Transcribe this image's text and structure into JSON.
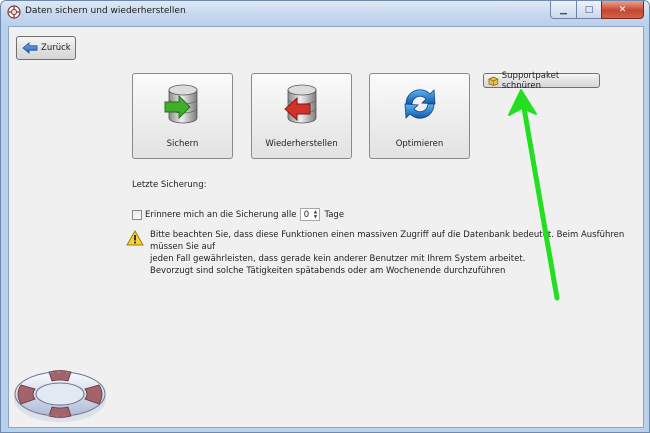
{
  "window": {
    "title": "Daten sichern und wiederherstellen",
    "controls": {
      "minimize": "▁",
      "maximize": "□",
      "close": "✕"
    }
  },
  "toolbar": {
    "back_label": "Zurück"
  },
  "actions": {
    "backup_label": "Sichern",
    "restore_label": "Wiederherstellen",
    "optimize_label": "Optimieren",
    "support_label": "Supportpaket schnüren"
  },
  "status": {
    "last_backup_label": "Letzte Sicherung:",
    "remind_prefix": "Erinnere mich an die Sicherung alle",
    "remind_value": "0",
    "remind_suffix": "Tage"
  },
  "warning": {
    "line1": "Bitte beachten Sie, dass diese Funktionen einen massiven Zugriff auf die Datenbank bedeutet. Beim Ausführen müssen Sie auf",
    "line2": "jeden Fall gewährleisten, dass gerade kein anderer Benutzer mit Ihrem System arbeitet.",
    "line3": "Bevorzugt sind solche Tätigkeiten spätabends oder am Wochenende durchzuführen"
  },
  "icons": {
    "app": "app-icon",
    "back": "back-arrow-icon",
    "backup": "database-backup-icon",
    "restore": "database-restore-icon",
    "optimize": "refresh-icon",
    "support": "package-icon",
    "warning": "warning-icon",
    "decoration": "lifebuoy-icon"
  },
  "colors": {
    "accent_blue": "#1f6fcf",
    "annotation_green": "#22e01f",
    "close_red": "#c7462e"
  }
}
